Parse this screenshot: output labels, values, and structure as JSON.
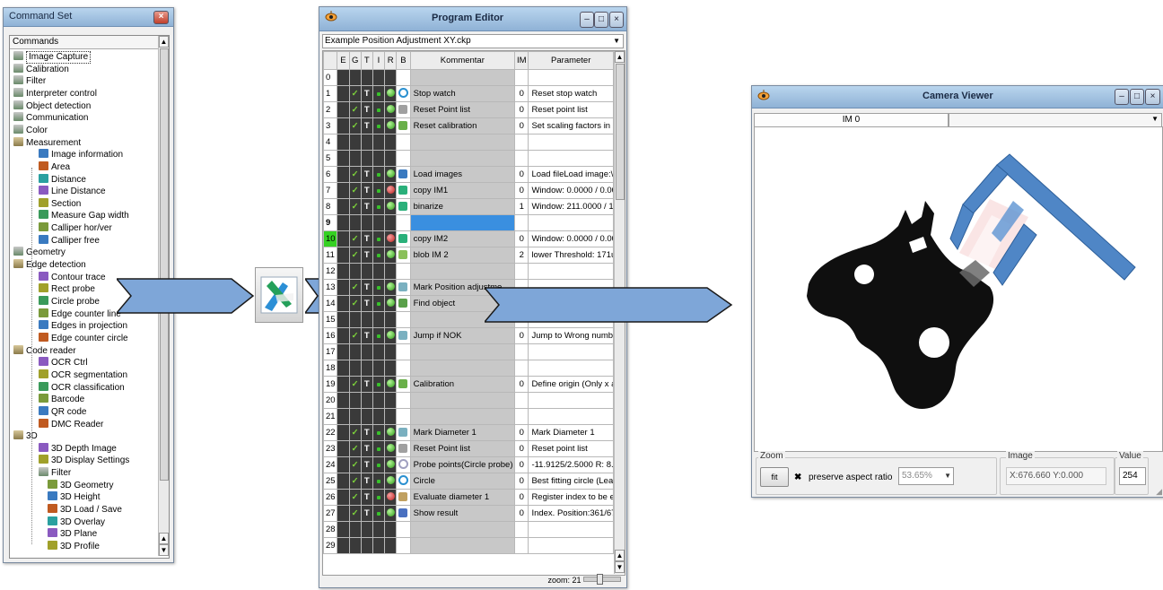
{
  "command_set": {
    "title": "Command Set",
    "header": "Commands",
    "items": [
      {
        "label": "Image Capture",
        "level": 1,
        "icon": "folder-icon",
        "selected": true
      },
      {
        "label": "Calibration",
        "level": 1,
        "icon": "folder-icon"
      },
      {
        "label": "Filter",
        "level": 1,
        "icon": "folder-icon"
      },
      {
        "label": "Interpreter control",
        "level": 1,
        "icon": "folder-icon"
      },
      {
        "label": "Object detection",
        "level": 1,
        "icon": "folder-icon"
      },
      {
        "label": "Communication",
        "level": 1,
        "icon": "folder-icon"
      },
      {
        "label": "Color",
        "level": 1,
        "icon": "folder-icon"
      },
      {
        "label": "Measurement",
        "level": 1,
        "icon": "folder-open-icon"
      },
      {
        "label": "Image information",
        "level": 2,
        "icon": "image-info-icon"
      },
      {
        "label": "Area",
        "level": 2,
        "icon": "area-icon"
      },
      {
        "label": "Distance",
        "level": 2,
        "icon": "distance-icon"
      },
      {
        "label": "Line Distance",
        "level": 2,
        "icon": "line-distance-icon"
      },
      {
        "label": "Section",
        "level": 2,
        "icon": "section-icon"
      },
      {
        "label": "Measure Gap width",
        "level": 2,
        "icon": "gap-width-icon"
      },
      {
        "label": "Calliper hor/ver",
        "level": 2,
        "icon": "calliper-icon"
      },
      {
        "label": "Calliper free",
        "level": 2,
        "icon": "calliper-free-icon"
      },
      {
        "label": "Geometry",
        "level": 1,
        "icon": "folder-icon"
      },
      {
        "label": "Edge detection",
        "level": 1,
        "icon": "folder-open-icon"
      },
      {
        "label": "Contour trace",
        "level": 2,
        "icon": "contour-icon"
      },
      {
        "label": "Rect probe",
        "level": 2,
        "icon": "rect-probe-icon"
      },
      {
        "label": "Circle probe",
        "level": 2,
        "icon": "circle-probe-icon"
      },
      {
        "label": "Edge counter line",
        "level": 2,
        "icon": "edge-counter-line-icon"
      },
      {
        "label": "Edges in projection",
        "level": 2,
        "icon": "projection-icon"
      },
      {
        "label": "Edge counter circle",
        "level": 2,
        "icon": "edge-counter-circle-icon"
      },
      {
        "label": "Code reader",
        "level": 1,
        "icon": "folder-open-icon"
      },
      {
        "label": "OCR Ctrl",
        "level": 2,
        "icon": "ocr-icon"
      },
      {
        "label": "OCR segmentation",
        "level": 2,
        "icon": "ocr-seg-icon"
      },
      {
        "label": "OCR classification",
        "level": 2,
        "icon": "ocr-class-icon"
      },
      {
        "label": "Barcode",
        "level": 2,
        "icon": "barcode-icon"
      },
      {
        "label": "QR code",
        "level": 2,
        "icon": "qr-icon"
      },
      {
        "label": "DMC Reader",
        "level": 2,
        "icon": "dmc-icon"
      },
      {
        "label": "3D",
        "level": 1,
        "icon": "folder-open-icon"
      },
      {
        "label": "3D Depth Image",
        "level": 2,
        "icon": "depth-icon"
      },
      {
        "label": "3D Display Settings",
        "level": 2,
        "icon": "display-settings-icon"
      },
      {
        "label": "Filter",
        "level": 2,
        "icon": "folder-icon"
      },
      {
        "label": "3D Geometry",
        "level": 3,
        "icon": "geometry-3d-icon"
      },
      {
        "label": "3D Height",
        "level": 3,
        "icon": "height-icon"
      },
      {
        "label": "3D Load / Save",
        "level": 3,
        "icon": "load-save-icon"
      },
      {
        "label": "3D Overlay",
        "level": 3,
        "icon": "overlay-icon"
      },
      {
        "label": "3D Plane",
        "level": 3,
        "icon": "plane-icon"
      },
      {
        "label": "3D Profile",
        "level": 3,
        "icon": "profile-icon"
      }
    ]
  },
  "program_editor": {
    "title": "Program Editor",
    "file": "Example Position Adjustment XY.ckp",
    "columns": [
      "",
      "E",
      "G",
      "T",
      "I",
      "R",
      "B",
      "Kommentar",
      "IM",
      "Parameter"
    ],
    "zoom_label": "zoom: 21",
    "rows": [
      {
        "n": "0",
        "on": false,
        "kom": "",
        "im": "",
        "par": "",
        "r": ""
      },
      {
        "n": "1",
        "on": true,
        "kom": "Stop watch",
        "im": "0",
        "par": "Reset stop watch",
        "r": "g",
        "icon": "stopwatch-icon"
      },
      {
        "n": "2",
        "on": true,
        "kom": "Reset Point list",
        "im": "0",
        "par": "Reset point list",
        "r": "g",
        "icon": "point-list-icon"
      },
      {
        "n": "3",
        "on": true,
        "kom": "Reset calibration",
        "im": "0",
        "par": "Set scaling factors in x a",
        "r": "g",
        "icon": "calibration-icon"
      },
      {
        "n": "4",
        "on": false,
        "kom": "",
        "im": "",
        "par": "",
        "r": ""
      },
      {
        "n": "5",
        "on": false,
        "kom": "",
        "im": "",
        "par": "",
        "r": ""
      },
      {
        "n": "6",
        "on": true,
        "kom": "Load images",
        "im": "0",
        "par": "Load fileLoad image:\\Tra",
        "r": "g",
        "icon": "load-images-icon"
      },
      {
        "n": "7",
        "on": true,
        "kom": "copy IM1",
        "im": "0",
        "par": "Window: 0.0000 / 0.000",
        "r": "r",
        "icon": "copy-icon"
      },
      {
        "n": "8",
        "on": true,
        "kom": "binarize",
        "im": "1",
        "par": "Window: 211.0000 / 155",
        "r": "g",
        "icon": "binarize-icon"
      },
      {
        "n": "9",
        "on": false,
        "kom": "",
        "im": "",
        "par": "",
        "r": "",
        "bold": true,
        "blue": true
      },
      {
        "n": "10",
        "on": true,
        "kom": "copy IM2",
        "im": "0",
        "par": "Window: 0.0000 / 0.000",
        "r": "r",
        "icon": "copy-icon",
        "green": true
      },
      {
        "n": "11",
        "on": true,
        "kom": "blob IM 2",
        "im": "2",
        "par": "lower Threshold: 171upp",
        "r": "g",
        "icon": "blob-icon"
      },
      {
        "n": "12",
        "on": false,
        "kom": "",
        "im": "",
        "par": "",
        "r": ""
      },
      {
        "n": "13",
        "on": true,
        "kom": "Mark Position adjustme",
        "im": "",
        "par": "",
        "r": "g",
        "icon": "mark-icon"
      },
      {
        "n": "14",
        "on": true,
        "kom": "Find object",
        "im": "",
        "par": "",
        "r": "g",
        "icon": "find-object-icon"
      },
      {
        "n": "15",
        "on": false,
        "kom": "",
        "im": "",
        "par": "",
        "r": ""
      },
      {
        "n": "16",
        "on": true,
        "kom": "Jump if NOK",
        "im": "0",
        "par": "Jump to Wrong number",
        "r": "g",
        "icon": "jump-icon"
      },
      {
        "n": "17",
        "on": false,
        "kom": "",
        "im": "",
        "par": "",
        "r": ""
      },
      {
        "n": "18",
        "on": false,
        "kom": "",
        "im": "",
        "par": "",
        "r": ""
      },
      {
        "n": "19",
        "on": true,
        "kom": "Calibration",
        "im": "0",
        "par": "Define origin (Only x and",
        "r": "g",
        "icon": "calibration-icon"
      },
      {
        "n": "20",
        "on": false,
        "kom": "",
        "im": "",
        "par": "",
        "r": ""
      },
      {
        "n": "21",
        "on": false,
        "kom": "",
        "im": "",
        "par": "",
        "r": ""
      },
      {
        "n": "22",
        "on": true,
        "kom": "Mark Diameter 1",
        "im": "0",
        "par": "Mark Diameter 1",
        "r": "g",
        "icon": "mark-icon"
      },
      {
        "n": "23",
        "on": true,
        "kom": "Reset Point list",
        "im": "0",
        "par": "Reset point list",
        "r": "g",
        "icon": "point-list-icon"
      },
      {
        "n": "24",
        "on": true,
        "kom": "Probe points(Circle probe)",
        "im": "0",
        "par": "-11.9125/2.5000 R: 8.1",
        "r": "g",
        "icon": "circle-probe-icon"
      },
      {
        "n": "25",
        "on": true,
        "kom": "Circle",
        "im": "0",
        "par": "Best fitting circle (Least s",
        "r": "g",
        "icon": "circle-icon"
      },
      {
        "n": "26",
        "on": true,
        "kom": "Evaluate diameter 1",
        "im": "0",
        "par": "Register index to be eva",
        "r": "r",
        "icon": "evaluate-icon"
      },
      {
        "n": "27",
        "on": true,
        "kom": "Show result",
        "im": "0",
        "par": "Index. Position:361/67",
        "r": "g",
        "icon": "show-result-icon"
      },
      {
        "n": "28",
        "on": false,
        "kom": "",
        "im": "",
        "par": "",
        "r": ""
      },
      {
        "n": "29",
        "on": false,
        "kom": "",
        "im": "",
        "par": "",
        "r": ""
      }
    ]
  },
  "camera_viewer": {
    "title": "Camera Viewer",
    "tab": "IM 0",
    "zoom_group": "Zoom",
    "fit_button": "fit",
    "preserve_label": "preserve aspect ratio",
    "zoom_value": "53.65%",
    "image_group": "Image",
    "coords": "X:676.660  Y:0.000",
    "value_group": "Value",
    "value": "254"
  },
  "colors": {
    "arrow": "#7ea6d8",
    "calliper": "#4f86c6",
    "part": "#111111"
  }
}
